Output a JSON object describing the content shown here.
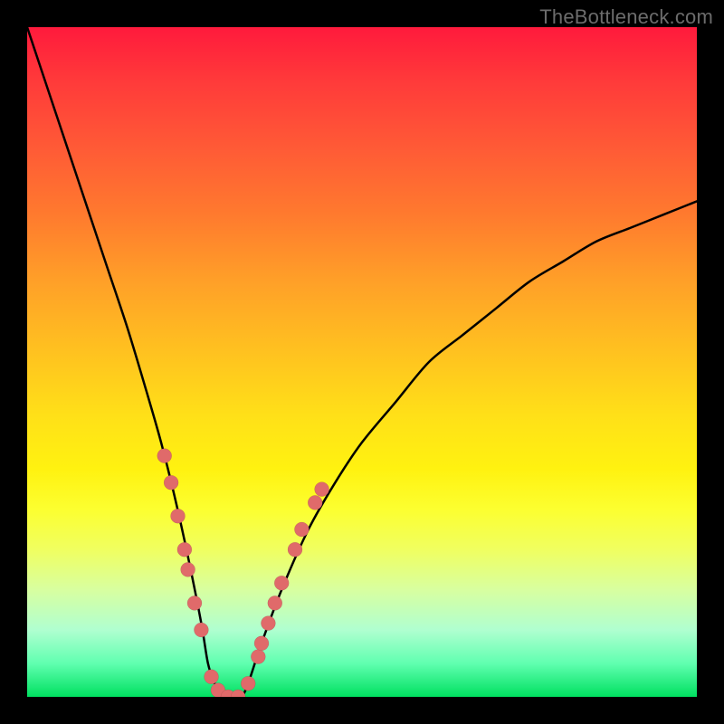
{
  "watermark": "TheBottleneck.com",
  "chart_data": {
    "type": "line",
    "title": "",
    "xlabel": "",
    "ylabel": "",
    "xlim": [
      0,
      100
    ],
    "ylim": [
      0,
      100
    ],
    "grid": false,
    "legend": false,
    "background_gradient": {
      "top": "#ff1a3c",
      "bottom": "#00e060",
      "meaning": "red top (high bottleneck %) fading through orange/yellow to green bottom (low bottleneck %)"
    },
    "series": [
      {
        "name": "bottleneck-curve",
        "color": "#000000",
        "comment": "x is relative component scale (0-100), y is bottleneck percentage (0-100). Curve drops steeply from 100 at x=0 to 0 near x≈27, stays near 0 until x≈33, then rises with decreasing slope toward ~74 at x=100.",
        "x": [
          0,
          3,
          6,
          9,
          12,
          15,
          18,
          20,
          22,
          24,
          26,
          27,
          28,
          29,
          30,
          31,
          32,
          33,
          35,
          38,
          42,
          46,
          50,
          55,
          60,
          65,
          70,
          75,
          80,
          85,
          90,
          95,
          100
        ],
        "y": [
          100,
          91,
          82,
          73,
          64,
          55,
          45,
          38,
          30,
          21,
          11,
          5,
          2,
          0,
          0,
          0,
          0,
          2,
          8,
          16,
          25,
          32,
          38,
          44,
          50,
          54,
          58,
          62,
          65,
          68,
          70,
          72,
          74
        ]
      }
    ],
    "markers": {
      "name": "highlighted-dots",
      "color": "#e06a6a",
      "comment": "pink dots marking specific sampled points along the curve near the valley and the early rise",
      "points": [
        {
          "x": 20.5,
          "y": 36
        },
        {
          "x": 21.5,
          "y": 32
        },
        {
          "x": 22.5,
          "y": 27
        },
        {
          "x": 23.5,
          "y": 22
        },
        {
          "x": 24.0,
          "y": 19
        },
        {
          "x": 25.0,
          "y": 14
        },
        {
          "x": 26.0,
          "y": 10
        },
        {
          "x": 27.5,
          "y": 3
        },
        {
          "x": 28.5,
          "y": 1
        },
        {
          "x": 30.0,
          "y": 0
        },
        {
          "x": 31.5,
          "y": 0
        },
        {
          "x": 33.0,
          "y": 2
        },
        {
          "x": 34.5,
          "y": 6
        },
        {
          "x": 35.0,
          "y": 8
        },
        {
          "x": 36.0,
          "y": 11
        },
        {
          "x": 37.0,
          "y": 14
        },
        {
          "x": 38.0,
          "y": 17
        },
        {
          "x": 40.0,
          "y": 22
        },
        {
          "x": 41.0,
          "y": 25
        },
        {
          "x": 43.0,
          "y": 29
        },
        {
          "x": 44.0,
          "y": 31
        }
      ]
    }
  }
}
